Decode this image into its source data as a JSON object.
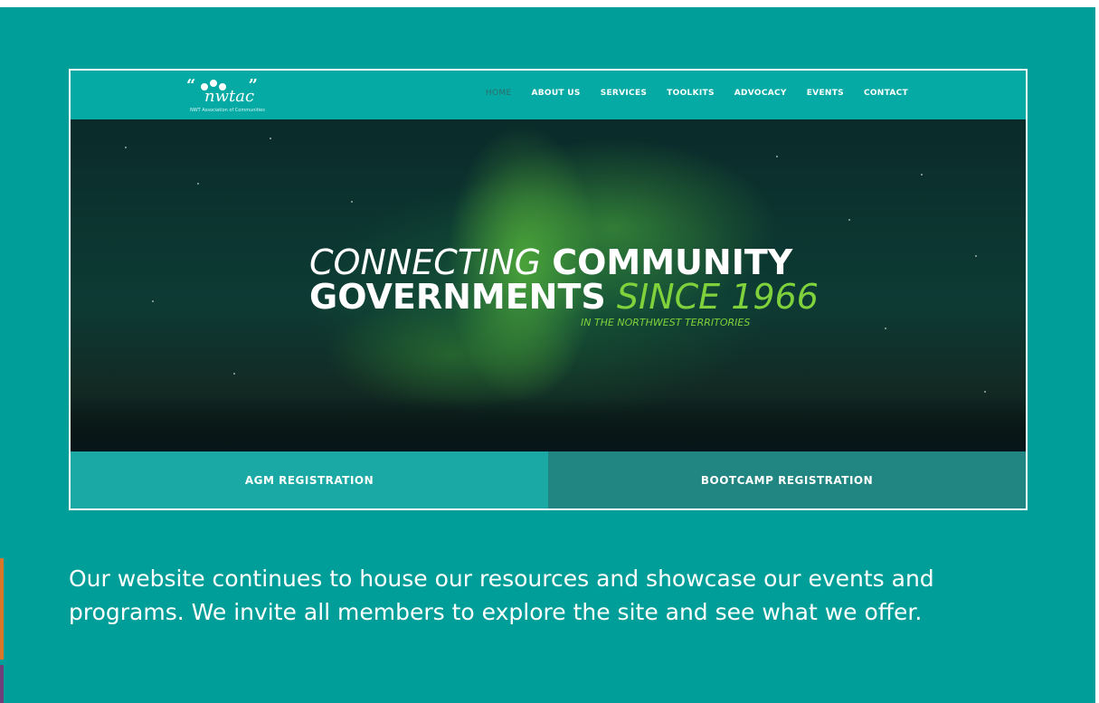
{
  "logo": {
    "quotes": "“ ”",
    "wordmark": "nwtac",
    "tagline": "NWT Association of Communities"
  },
  "nav": {
    "items": [
      {
        "label": "HOME",
        "active": true
      },
      {
        "label": "ABOUT US",
        "active": false
      },
      {
        "label": "SERVICES",
        "active": false
      },
      {
        "label": "TOOLKITS",
        "active": false
      },
      {
        "label": "ADVOCACY",
        "active": false
      },
      {
        "label": "EVENTS",
        "active": false
      },
      {
        "label": "CONTACT",
        "active": false
      }
    ]
  },
  "hero": {
    "word1": "CONNECTING",
    "word2": "COMMUNITY",
    "word3": "GOVERNMENTS",
    "word4": "SINCE 1966",
    "subline": "IN THE NORTHWEST TERRITORIES"
  },
  "registration": {
    "agm_label": "AGM REGISTRATION",
    "bootcamp_label": "BOOTCAMP REGISTRATION"
  },
  "caption": {
    "text": "Our website continues to house our resources and showcase our events and programs. We invite all members to explore the site and see what we offer."
  },
  "colors": {
    "page_background": "#009e98",
    "header": "#05aaa4",
    "accent_green": "#7fd23c",
    "agm_button": "#1aa9a4",
    "bootcamp_button": "#218581"
  }
}
